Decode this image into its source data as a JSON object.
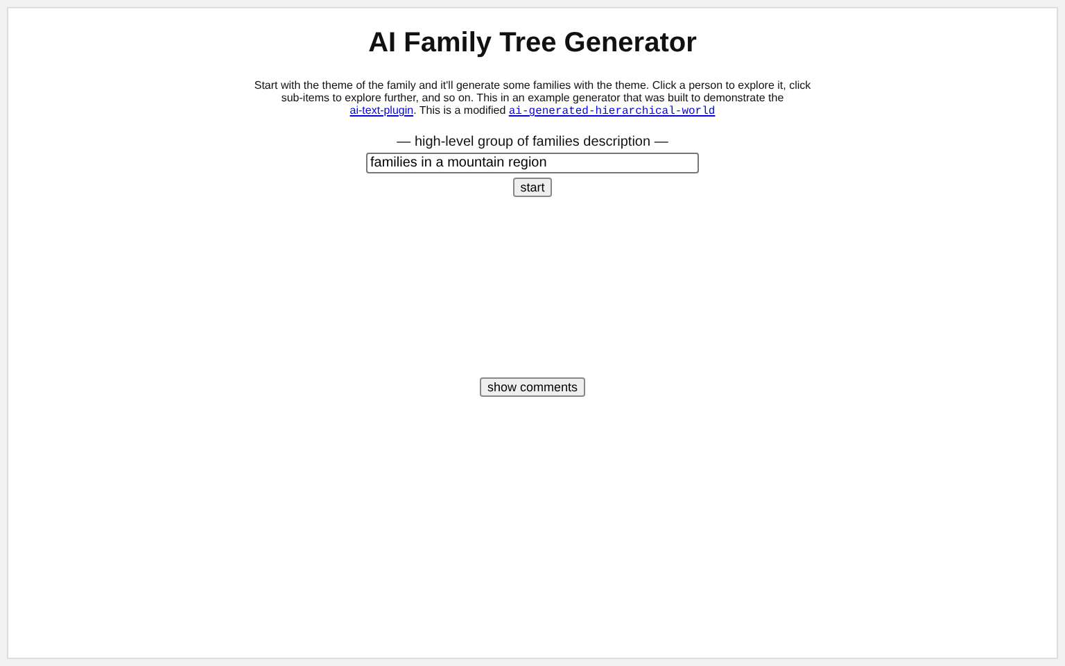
{
  "title": "AI Family Tree Generator",
  "description": [
    {
      "kind": "text",
      "text": "Start with the theme of the family and it'll generate some families with the theme. Click a person to explore it, click sub-items to explore further, and so on. This in an example generator that was built to demonstrate the "
    },
    {
      "kind": "link",
      "text": "ai-text-plugin"
    },
    {
      "kind": "text",
      "text": ". This is a modified "
    },
    {
      "kind": "code-link",
      "text": "ai-generated-hierarchical-world"
    }
  ],
  "input_label": "— high-level group of families description —",
  "input": {
    "value": "families in a mountain region"
  },
  "start_button": "start",
  "comments_button": "show comments"
}
